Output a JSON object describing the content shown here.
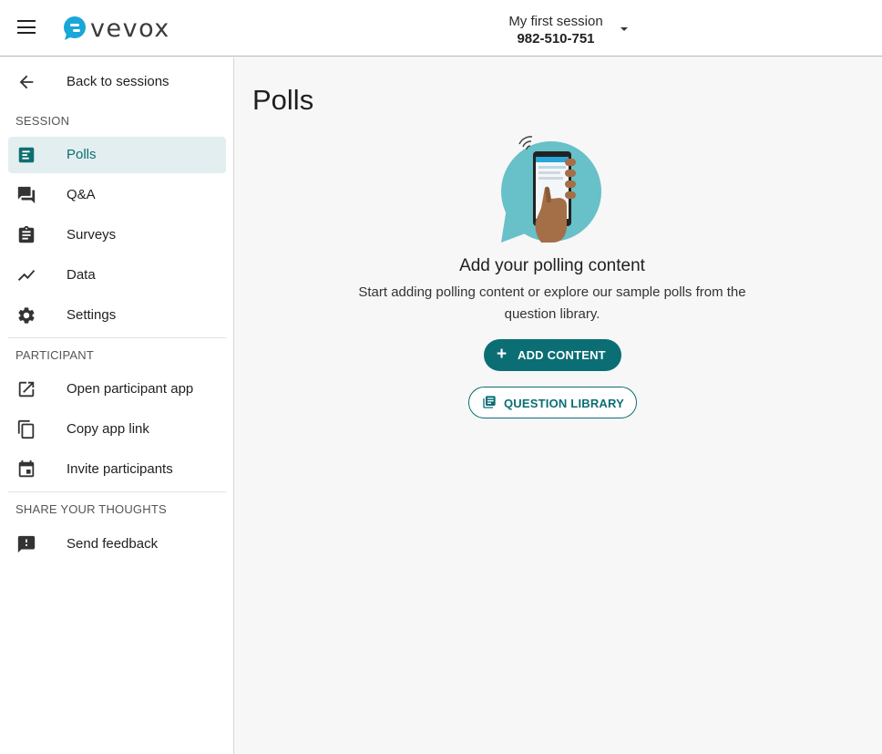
{
  "header": {
    "brand": "vevox",
    "session_name": "My first session",
    "session_code": "982-510-751"
  },
  "sidebar": {
    "back_label": "Back to sessions",
    "sections": [
      {
        "title": "SESSION"
      },
      {
        "title": "PARTICIPANT"
      },
      {
        "title": "SHARE YOUR THOUGHTS"
      }
    ],
    "items": [
      {
        "label": "Polls",
        "icon": "polls-icon",
        "active": true
      },
      {
        "label": "Q&A",
        "icon": "forum-icon"
      },
      {
        "label": "Surveys",
        "icon": "clipboard-icon"
      },
      {
        "label": "Data",
        "icon": "trend-icon"
      },
      {
        "label": "Settings",
        "icon": "gear-icon"
      },
      {
        "label": "Open participant app",
        "icon": "open-external-icon"
      },
      {
        "label": "Copy app link",
        "icon": "copy-icon"
      },
      {
        "label": "Invite participants",
        "icon": "calendar-icon"
      },
      {
        "label": "Send feedback",
        "icon": "feedback-icon"
      }
    ]
  },
  "main": {
    "title": "Polls",
    "empty_title": "Add your polling content",
    "empty_desc_line1": "Start adding polling content or explore our sample polls from the",
    "empty_desc_line2": "question library.",
    "add_button": "ADD CONTENT",
    "library_button": "QUESTION LIBRARY"
  },
  "colors": {
    "accent": "#0b6e74",
    "active_bg": "#e2eeef",
    "bubble": "#68c0c8",
    "logo_blue": "#1aa6d9"
  }
}
